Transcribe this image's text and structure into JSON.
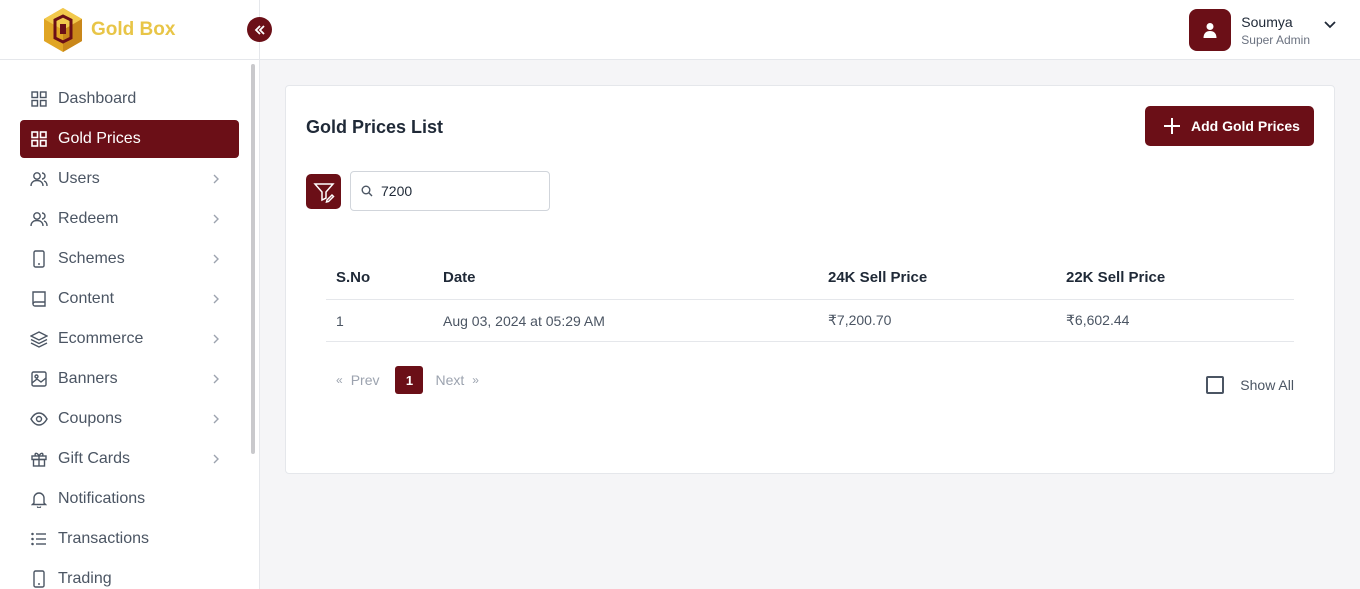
{
  "brand": {
    "name": "Gold Box",
    "logo": "gold-box-logo"
  },
  "sidebar": {
    "items": [
      {
        "label": "Dashboard",
        "icon": "grid-icon",
        "active": false,
        "has_submenu": false
      },
      {
        "label": "Gold Prices",
        "icon": "grid-icon",
        "active": true,
        "has_submenu": false
      },
      {
        "label": "Users",
        "icon": "users-icon",
        "active": false,
        "has_submenu": true
      },
      {
        "label": "Redeem",
        "icon": "users-icon",
        "active": false,
        "has_submenu": true
      },
      {
        "label": "Schemes",
        "icon": "tablet-icon",
        "active": false,
        "has_submenu": true
      },
      {
        "label": "Content",
        "icon": "book-icon",
        "active": false,
        "has_submenu": true
      },
      {
        "label": "Ecommerce",
        "icon": "layers-icon",
        "active": false,
        "has_submenu": true
      },
      {
        "label": "Banners",
        "icon": "image-icon",
        "active": false,
        "has_submenu": true
      },
      {
        "label": "Coupons",
        "icon": "eye-icon",
        "active": false,
        "has_submenu": true
      },
      {
        "label": "Gift Cards",
        "icon": "gift-icon",
        "active": false,
        "has_submenu": true
      },
      {
        "label": "Notifications",
        "icon": "bell-icon",
        "active": false,
        "has_submenu": false
      },
      {
        "label": "Transactions",
        "icon": "list-icon",
        "active": false,
        "has_submenu": false
      },
      {
        "label": "Trading",
        "icon": "tablet-icon",
        "active": false,
        "has_submenu": false
      }
    ]
  },
  "header": {
    "user": {
      "name": "Soumya",
      "role": "Super Admin"
    }
  },
  "main": {
    "title": "Gold Prices List",
    "add_button_label": "Add Gold Prices",
    "search": {
      "value": "7200",
      "placeholder": ""
    },
    "table": {
      "columns": [
        "S.No",
        "Date",
        "24K Sell Price",
        "22K Sell Price"
      ],
      "rows": [
        [
          "1",
          "Aug 03, 2024 at 05:29 AM",
          "₹7,200.70",
          "₹6,602.44"
        ]
      ]
    },
    "pagination": {
      "first": "«",
      "prev": "Prev",
      "current": "1",
      "next": "Next",
      "last": "»"
    },
    "show_all_label": "Show All"
  },
  "colors": {
    "primary": "#6b0f17",
    "brand_gold": "#e8c547"
  }
}
